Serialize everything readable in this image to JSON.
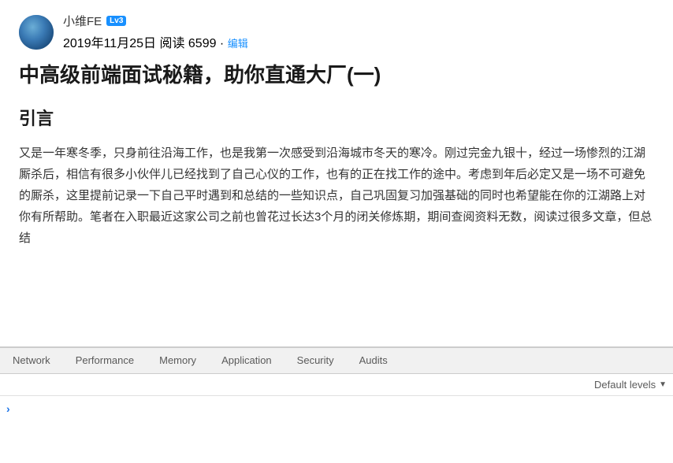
{
  "author": {
    "name": "小维FE",
    "badge": "Lv3",
    "meta": "2019年11月25日  阅读 6599 · ",
    "edit_label": "编辑"
  },
  "article": {
    "title": "中高级前端面试秘籍，助你直通大厂(一)",
    "section_heading": "引言",
    "body_text": "又是一年寒冬季，只身前往沿海工作，也是我第一次感受到沿海城市冬天的寒冷。刚过完金九银十，经过一场惨烈的江湖厮杀后，相信有很多小伙伴儿已经找到了自己心仪的工作，也有的正在找工作的途中。考虑到年后必定又是一场不可避免的厮杀，这里提前记录一下自己平时遇到和总结的一些知识点，自己巩固复习加强基础的同时也希望能在你的江湖路上对你有所帮助。笔者在入职最近这家公司之前也曾花过长达3个月的闭关修炼期，期间查阅资料无数，阅读过很多文章，但总结"
  },
  "devtools": {
    "tabs": [
      {
        "label": "Network"
      },
      {
        "label": "Performance"
      },
      {
        "label": "Memory"
      },
      {
        "label": "Application"
      },
      {
        "label": "Security"
      },
      {
        "label": "Audits"
      }
    ],
    "console": {
      "filter_placeholder": "",
      "default_levels_label": "Default levels",
      "dropdown_symbol": "▼"
    }
  }
}
